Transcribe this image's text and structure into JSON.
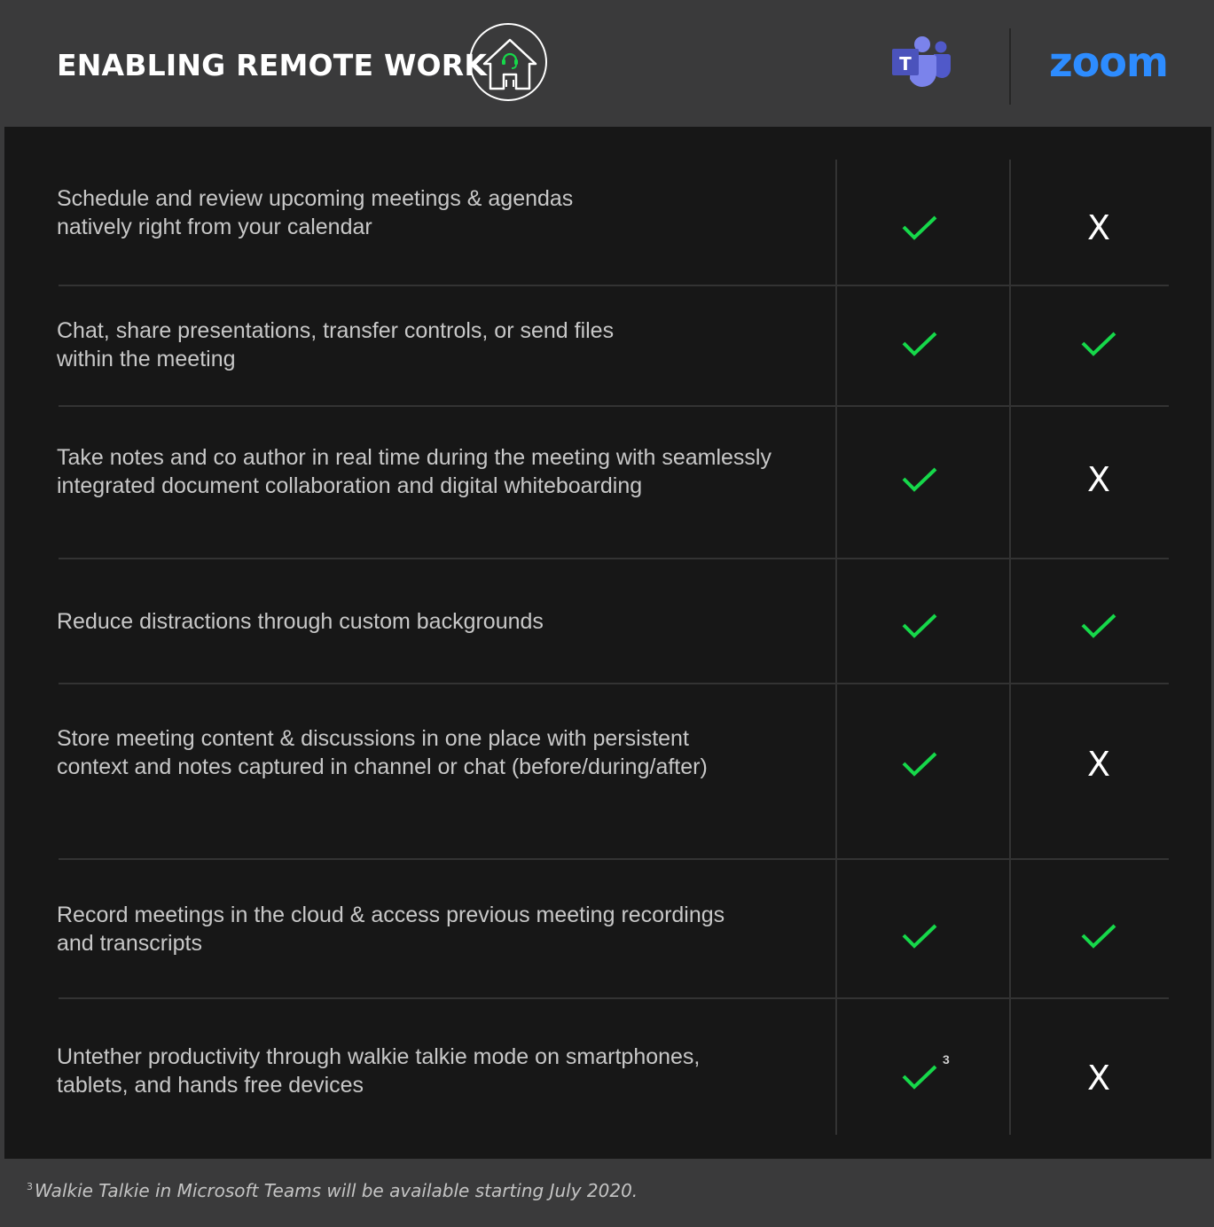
{
  "header": {
    "title": "ENABLING REMOTE WORK",
    "house_icon": "remote-work-house-icon",
    "teams_logo_letter": "T",
    "zoom_logo_text": "zoom"
  },
  "colors": {
    "background": "#3a3a3b",
    "panel": "#171717",
    "check_green": "#16d84a",
    "cross_white": "#ffffff",
    "zoom_blue": "#2d8cff",
    "teams_purple": "#5059c9"
  },
  "rows": [
    {
      "line1": "Schedule and review upcoming meetings & agendas",
      "line2": "natively right from your calendar",
      "teams": "check",
      "zoom": "cross",
      "zoom_text": "X"
    },
    {
      "line1": "Chat, share presentations, transfer controls, or send files",
      "line2": "within the meeting",
      "teams": "check",
      "zoom": "check"
    },
    {
      "line1": "Take notes and co author in real time during the meeting with seamlessly",
      "line2": "integrated document collaboration and digital whiteboarding",
      "teams": "check",
      "zoom": "cross",
      "zoom_text": "X"
    },
    {
      "line1": "Reduce distractions through custom backgrounds",
      "line2": "",
      "teams": "check",
      "zoom": "check"
    },
    {
      "line1": "Store meeting content & discussions in one place with persistent",
      "line2": "context and notes captured in channel or chat (before/during/after)",
      "teams": "check",
      "zoom": "cross",
      "zoom_text": "X"
    },
    {
      "line1": "Record meetings in the cloud & access previous meeting recordings",
      "line2": "and transcripts",
      "teams": "check",
      "zoom": "check"
    },
    {
      "line1": "Untether productivity through walkie talkie mode on smartphones,",
      "line2": "tablets, and hands free devices",
      "teams": "check",
      "teams_sup": "3",
      "zoom": "cross",
      "zoom_text": "X"
    }
  ],
  "footnote": {
    "number": "3",
    "text": "Walkie Talkie in Microsoft Teams will be available starting July 2020."
  }
}
